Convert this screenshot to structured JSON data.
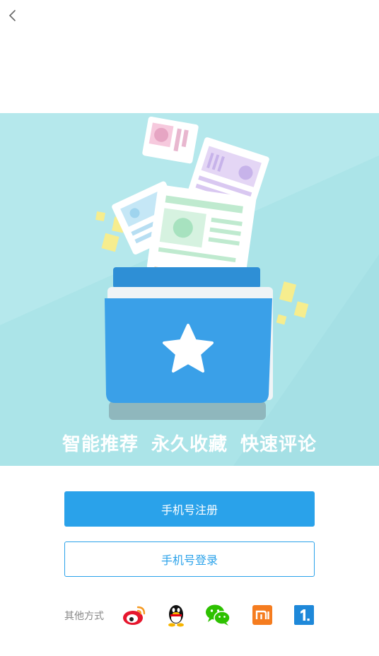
{
  "nav": {
    "back_icon": "chevron-left-icon"
  },
  "hero": {
    "tagline": "智能推荐  永久收藏  快速评论",
    "background": "#abe4e8",
    "folder_icon": "star-icon"
  },
  "actions": {
    "register_label": "手机号注册",
    "login_label": "手机号登录",
    "accent": "#2aa2ea"
  },
  "social": {
    "label": "其他方式",
    "providers": [
      {
        "icon": "weibo-icon"
      },
      {
        "icon": "qq-icon"
      },
      {
        "icon": "wechat-icon"
      },
      {
        "icon": "xiaomi-icon"
      },
      {
        "icon": "one-icon"
      }
    ]
  }
}
